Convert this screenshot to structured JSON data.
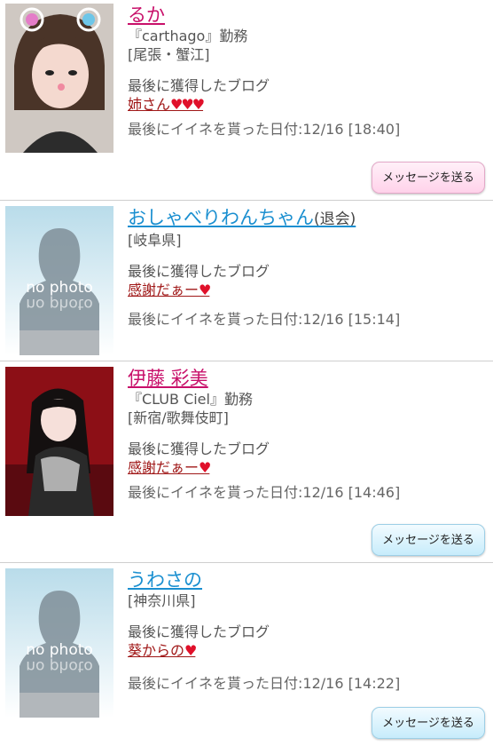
{
  "theme": {
    "pink_name": "#c8106a",
    "blue_name": "#1a8fd0",
    "blog_link": "#a01818",
    "heart": "#e0102a"
  },
  "common": {
    "last_blog_label": "最後に獲得したブログ",
    "nophoto_text": "no photo",
    "message_button_label": "メッセージを送る"
  },
  "users": [
    {
      "name": "るか",
      "shop": "『carthago』勤務",
      "area": "[尾張・蟹江]",
      "blog_title": "姉さん",
      "blog_hearts": "♥♥♥",
      "date_text": "最後にイイネを貰った日付:12/16 [18:40]"
    },
    {
      "name": "おしゃべりわんちゃん",
      "name_note": "(退会)",
      "area": "[岐阜県]",
      "blog_title": "感謝だぁー",
      "blog_hearts": "♥",
      "date_text": "最後にイイネを貰った日付:12/16 [15:14]"
    },
    {
      "name": "伊藤 彩美",
      "shop": "『CLUB Ciel』勤務",
      "area": "[新宿/歌舞伎町]",
      "blog_title": "感謝だぁー",
      "blog_hearts": "♥",
      "date_text": "最後にイイネを貰った日付:12/16 [14:46]"
    },
    {
      "name": "うわさの",
      "area": "[神奈川県]",
      "blog_title": "葵からの",
      "blog_hearts": "♥",
      "date_text": "最後にイイネを貰った日付:12/16 [14:22]"
    }
  ]
}
